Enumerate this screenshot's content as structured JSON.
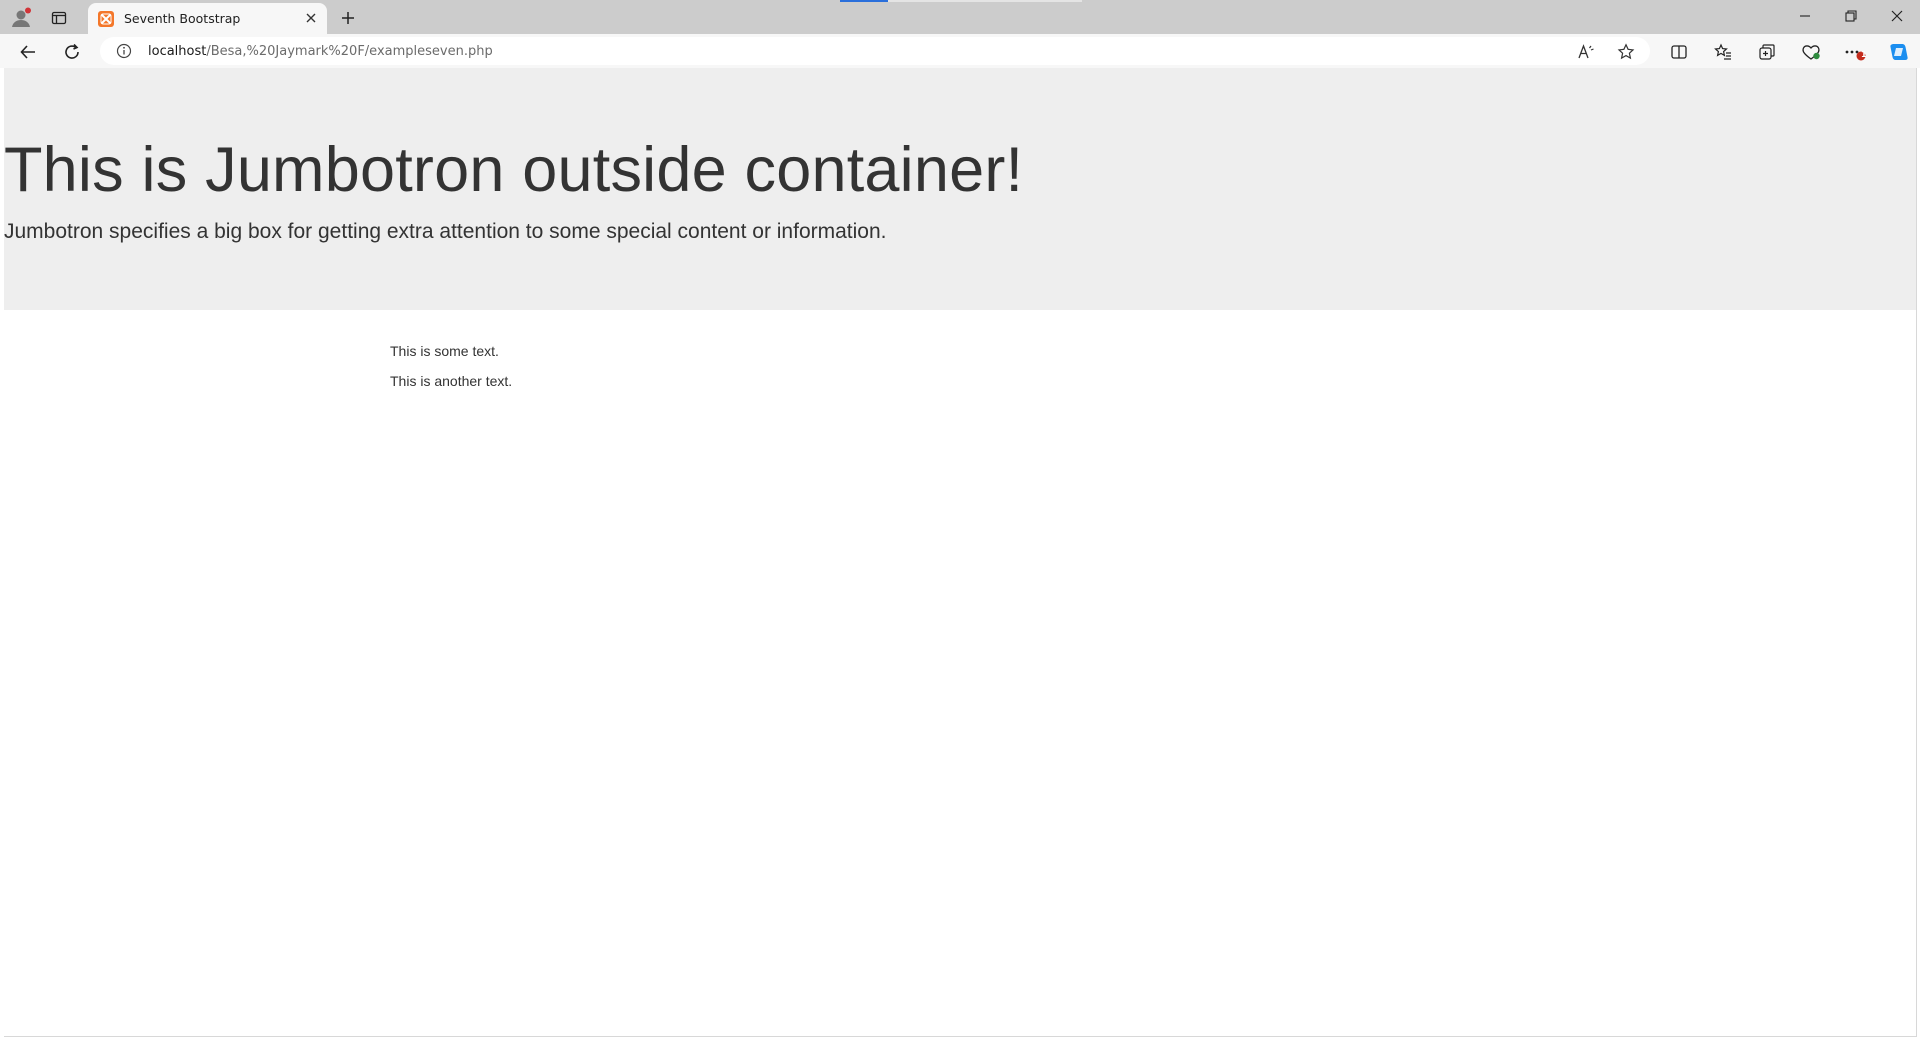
{
  "browser": {
    "tab": {
      "title": "Seventh Bootstrap"
    },
    "address": {
      "host": "localhost",
      "path": "/Besa,%20Jaymark%20F/exampleseven.php"
    },
    "colors": {
      "favicon": "#f4772a",
      "accent": "#2a6fdb",
      "notification_badge": "#c42b1c"
    },
    "icons": {
      "profile": "profile-icon",
      "tab_actions": "tab-actions-icon",
      "new_tab": "plus-icon",
      "back": "back-arrow-icon",
      "refresh": "refresh-icon",
      "info": "info-icon",
      "read_aloud": "read-aloud-icon",
      "favorite": "star-icon",
      "split_screen": "split-screen-icon",
      "favorites": "favorites-icon",
      "collections": "collections-icon",
      "extensions": "browser-essentials-icon",
      "more": "more-icon",
      "copilot": "copilot-icon"
    },
    "more_badge": "1"
  },
  "page": {
    "jumbotron": {
      "heading": "This is Jumbotron outside container!",
      "lead": "Jumbotron specifies a big box for getting extra attention to some special content or information.",
      "background": "#eeeeee"
    },
    "container": {
      "paragraphs": [
        "This is some text.",
        "This is another text."
      ]
    }
  }
}
